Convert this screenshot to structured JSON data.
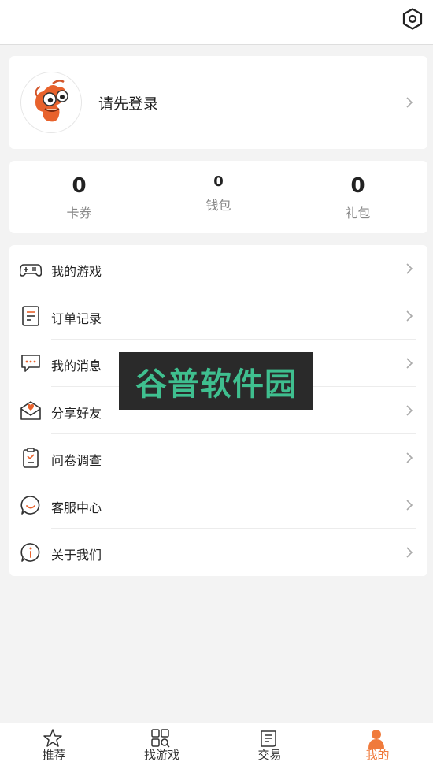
{
  "header": {
    "settings_icon": "settings-hex-icon"
  },
  "profile": {
    "login_prompt": "请先登录"
  },
  "stats": [
    {
      "value": "0",
      "label": "卡券"
    },
    {
      "value": "0",
      "label": "钱包"
    },
    {
      "value": "0",
      "label": "礼包"
    }
  ],
  "menu": {
    "items": [
      {
        "label": "我的游戏",
        "icon": "gamepad-icon"
      },
      {
        "label": "订单记录",
        "icon": "order-list-icon"
      },
      {
        "label": "我的消息",
        "icon": "message-icon"
      },
      {
        "label": "分享好友",
        "icon": "share-envelope-icon"
      },
      {
        "label": "问卷调查",
        "icon": "survey-icon"
      },
      {
        "label": "客服中心",
        "icon": "customer-service-icon"
      },
      {
        "label": "关于我们",
        "icon": "info-icon"
      }
    ]
  },
  "watermark": {
    "text": "谷普软件园"
  },
  "tabbar": {
    "tabs": [
      {
        "label": "推荐",
        "icon": "star-icon"
      },
      {
        "label": "找游戏",
        "icon": "grid-search-icon"
      },
      {
        "label": "交易",
        "icon": "document-icon"
      },
      {
        "label": "我的",
        "icon": "person-icon"
      }
    ],
    "active_color": "#f07a3b"
  }
}
